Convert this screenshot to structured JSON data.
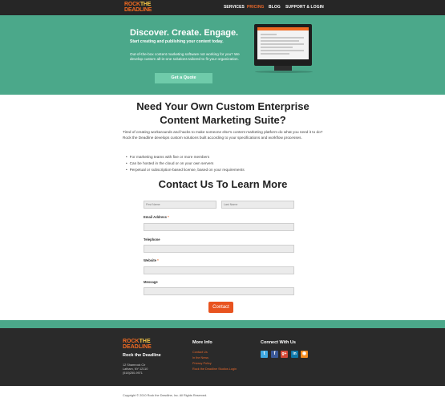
{
  "brand": {
    "logo_line1": "ROCK THE",
    "logo_line2": "DEADLINE",
    "logo_rock": "ROCK",
    "logo_the": "THE"
  },
  "nav": {
    "items": [
      "SERVICES",
      "PRICING",
      "BLOG",
      "SUPPORT & LOGIN"
    ],
    "active_index": 1
  },
  "hero": {
    "title": "Discover. Create. Engage.",
    "subtitle": "Start creating and publishing your content today.",
    "body": "Out-of-the-box content marketing software not working for you? We develop custom all-in-one solutions tailored to fit your organization.",
    "cta_label": "Get a Quote"
  },
  "main": {
    "title": "Need Your Own Custom Enterprise Content Marketing Suite?",
    "intro": "Tired of creating workarounds and hacks to make someone else's content marketing platform do what you need it to do? Rock the Deadline develops custom solutions built according to your specifications and workflow processes.",
    "bullets": [
      "For marketing teams with five or more members",
      "Can be hosted in the cloud or on your own servers",
      "Perpetual or subscription-based license, based on your requirements"
    ]
  },
  "contact": {
    "title": "Contact Us To Learn More",
    "first_name_placeholder": "First Name",
    "last_name_placeholder": "Last Name",
    "email_label": "Email Address",
    "telephone_label": "Telephone",
    "website_label": "Website",
    "message_label": "Message",
    "required_mark": "*",
    "submit_label": "Contact"
  },
  "footer": {
    "company": "Rock the Deadline",
    "address_line1": "12 Shamrock Cir",
    "address_line2": "Latham, NY 12110",
    "phone": "(518)250-9971",
    "more_info_title": "More Info",
    "links": [
      "Contact Us",
      "In the News",
      "Privacy Policy",
      "Rock the Deadline Studios Login"
    ],
    "connect_title": "Connect With Us",
    "social_icons": [
      "twitter-icon",
      "facebook-icon",
      "google-plus-icon",
      "linkedin-icon",
      "rss-icon"
    ],
    "copyright": "Copyright © 2010 Rock the Deadline, Inc. All Rights Reserved."
  },
  "colors": {
    "accent_green": "#4ba88a",
    "accent_orange": "#e9692c",
    "dark": "#262626"
  }
}
